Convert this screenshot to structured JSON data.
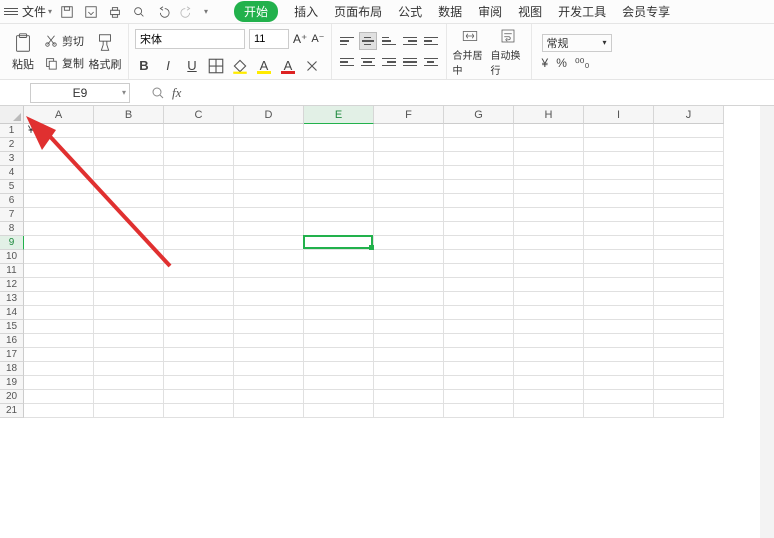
{
  "menu": {
    "file": "文件",
    "tabs": [
      "开始",
      "插入",
      "页面布局",
      "公式",
      "数据",
      "审阅",
      "视图",
      "开发工具",
      "会员专享"
    ],
    "active_tab": 0
  },
  "clipboard": {
    "paste": "粘贴",
    "cut": "剪切",
    "copy": "复制",
    "fmtpaint": "格式刷"
  },
  "font": {
    "name": "宋体",
    "size": "11",
    "btns": {
      "bold": "B",
      "italic": "I",
      "underline": "U",
      "strike": "A"
    }
  },
  "merge": {
    "merge": "合并居中",
    "wrap": "自动换行"
  },
  "number": {
    "label": "常规",
    "yen": "¥",
    "pct": "%",
    "split": "⁰⁰₀"
  },
  "name_box": "E9",
  "columns": [
    "A",
    "B",
    "C",
    "D",
    "E",
    "F",
    "G",
    "H",
    "I",
    "J"
  ],
  "row_count": 21,
  "selected": {
    "col": 4,
    "row": 8
  },
  "cells": {
    "A1": "￥"
  }
}
